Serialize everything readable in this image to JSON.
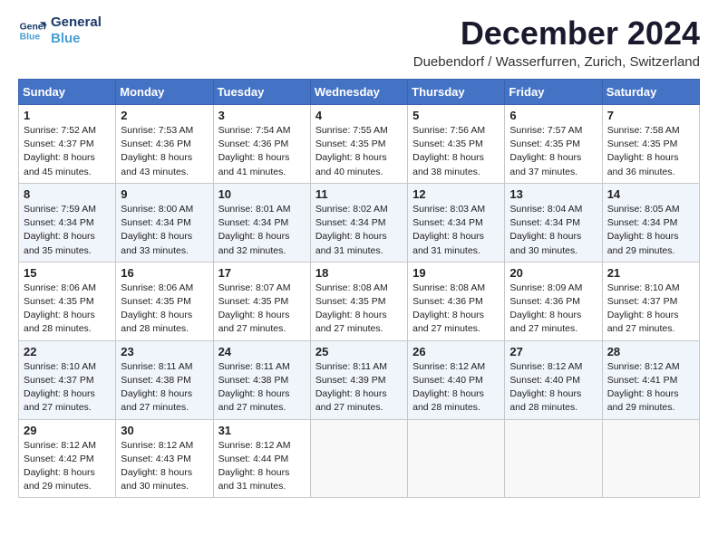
{
  "logo": {
    "line1": "General",
    "line2": "Blue"
  },
  "title": "December 2024",
  "location": "Duebendorf / Wasserfurren, Zurich, Switzerland",
  "days_of_week": [
    "Sunday",
    "Monday",
    "Tuesday",
    "Wednesday",
    "Thursday",
    "Friday",
    "Saturday"
  ],
  "weeks": [
    [
      {
        "day": 1,
        "sunrise": "7:52 AM",
        "sunset": "4:37 PM",
        "daylight": "8 hours and 45 minutes."
      },
      {
        "day": 2,
        "sunrise": "7:53 AM",
        "sunset": "4:36 PM",
        "daylight": "8 hours and 43 minutes."
      },
      {
        "day": 3,
        "sunrise": "7:54 AM",
        "sunset": "4:36 PM",
        "daylight": "8 hours and 41 minutes."
      },
      {
        "day": 4,
        "sunrise": "7:55 AM",
        "sunset": "4:35 PM",
        "daylight": "8 hours and 40 minutes."
      },
      {
        "day": 5,
        "sunrise": "7:56 AM",
        "sunset": "4:35 PM",
        "daylight": "8 hours and 38 minutes."
      },
      {
        "day": 6,
        "sunrise": "7:57 AM",
        "sunset": "4:35 PM",
        "daylight": "8 hours and 37 minutes."
      },
      {
        "day": 7,
        "sunrise": "7:58 AM",
        "sunset": "4:35 PM",
        "daylight": "8 hours and 36 minutes."
      }
    ],
    [
      {
        "day": 8,
        "sunrise": "7:59 AM",
        "sunset": "4:34 PM",
        "daylight": "8 hours and 35 minutes."
      },
      {
        "day": 9,
        "sunrise": "8:00 AM",
        "sunset": "4:34 PM",
        "daylight": "8 hours and 33 minutes."
      },
      {
        "day": 10,
        "sunrise": "8:01 AM",
        "sunset": "4:34 PM",
        "daylight": "8 hours and 32 minutes."
      },
      {
        "day": 11,
        "sunrise": "8:02 AM",
        "sunset": "4:34 PM",
        "daylight": "8 hours and 31 minutes."
      },
      {
        "day": 12,
        "sunrise": "8:03 AM",
        "sunset": "4:34 PM",
        "daylight": "8 hours and 31 minutes."
      },
      {
        "day": 13,
        "sunrise": "8:04 AM",
        "sunset": "4:34 PM",
        "daylight": "8 hours and 30 minutes."
      },
      {
        "day": 14,
        "sunrise": "8:05 AM",
        "sunset": "4:34 PM",
        "daylight": "8 hours and 29 minutes."
      }
    ],
    [
      {
        "day": 15,
        "sunrise": "8:06 AM",
        "sunset": "4:35 PM",
        "daylight": "8 hours and 28 minutes."
      },
      {
        "day": 16,
        "sunrise": "8:06 AM",
        "sunset": "4:35 PM",
        "daylight": "8 hours and 28 minutes."
      },
      {
        "day": 17,
        "sunrise": "8:07 AM",
        "sunset": "4:35 PM",
        "daylight": "8 hours and 27 minutes."
      },
      {
        "day": 18,
        "sunrise": "8:08 AM",
        "sunset": "4:35 PM",
        "daylight": "8 hours and 27 minutes."
      },
      {
        "day": 19,
        "sunrise": "8:08 AM",
        "sunset": "4:36 PM",
        "daylight": "8 hours and 27 minutes."
      },
      {
        "day": 20,
        "sunrise": "8:09 AM",
        "sunset": "4:36 PM",
        "daylight": "8 hours and 27 minutes."
      },
      {
        "day": 21,
        "sunrise": "8:10 AM",
        "sunset": "4:37 PM",
        "daylight": "8 hours and 27 minutes."
      }
    ],
    [
      {
        "day": 22,
        "sunrise": "8:10 AM",
        "sunset": "4:37 PM",
        "daylight": "8 hours and 27 minutes."
      },
      {
        "day": 23,
        "sunrise": "8:11 AM",
        "sunset": "4:38 PM",
        "daylight": "8 hours and 27 minutes."
      },
      {
        "day": 24,
        "sunrise": "8:11 AM",
        "sunset": "4:38 PM",
        "daylight": "8 hours and 27 minutes."
      },
      {
        "day": 25,
        "sunrise": "8:11 AM",
        "sunset": "4:39 PM",
        "daylight": "8 hours and 27 minutes."
      },
      {
        "day": 26,
        "sunrise": "8:12 AM",
        "sunset": "4:40 PM",
        "daylight": "8 hours and 28 minutes."
      },
      {
        "day": 27,
        "sunrise": "8:12 AM",
        "sunset": "4:40 PM",
        "daylight": "8 hours and 28 minutes."
      },
      {
        "day": 28,
        "sunrise": "8:12 AM",
        "sunset": "4:41 PM",
        "daylight": "8 hours and 29 minutes."
      }
    ],
    [
      {
        "day": 29,
        "sunrise": "8:12 AM",
        "sunset": "4:42 PM",
        "daylight": "8 hours and 29 minutes."
      },
      {
        "day": 30,
        "sunrise": "8:12 AM",
        "sunset": "4:43 PM",
        "daylight": "8 hours and 30 minutes."
      },
      {
        "day": 31,
        "sunrise": "8:12 AM",
        "sunset": "4:44 PM",
        "daylight": "8 hours and 31 minutes."
      },
      null,
      null,
      null,
      null
    ]
  ]
}
